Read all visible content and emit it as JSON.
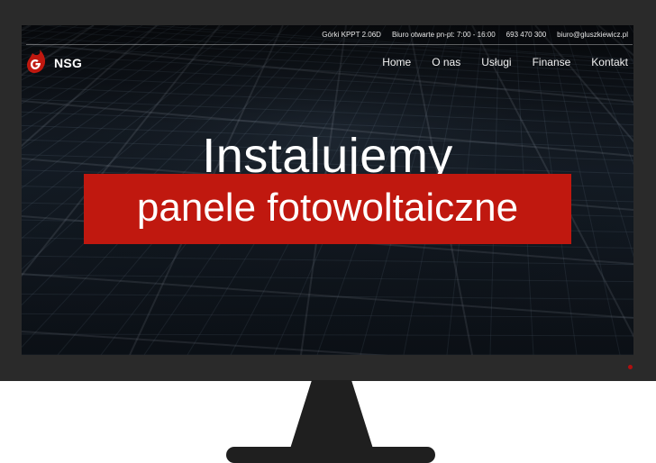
{
  "topbar": {
    "address": "Górki KPPT 2.06D",
    "hours": "Biuro otwarte pn-pt: 7:00 - 16:00",
    "phone": "693 470 300",
    "email": "biuro@gluszkiewicz.pl"
  },
  "brand": {
    "name": "NSG",
    "logo_icon": "flame-g-icon",
    "accent_color": "#c0180f"
  },
  "nav": {
    "items": [
      {
        "label": "Home"
      },
      {
        "label": "O nas"
      },
      {
        "label": "Usługi"
      },
      {
        "label": "Finanse"
      },
      {
        "label": "Kontakt"
      }
    ]
  },
  "hero": {
    "title": "Instalujemy",
    "subtitle": "panele fotowoltaiczne",
    "background": "solar-panels-photo"
  },
  "device": {
    "bezel_color": "#2a2a2a",
    "power_led_color": "#b01010"
  }
}
